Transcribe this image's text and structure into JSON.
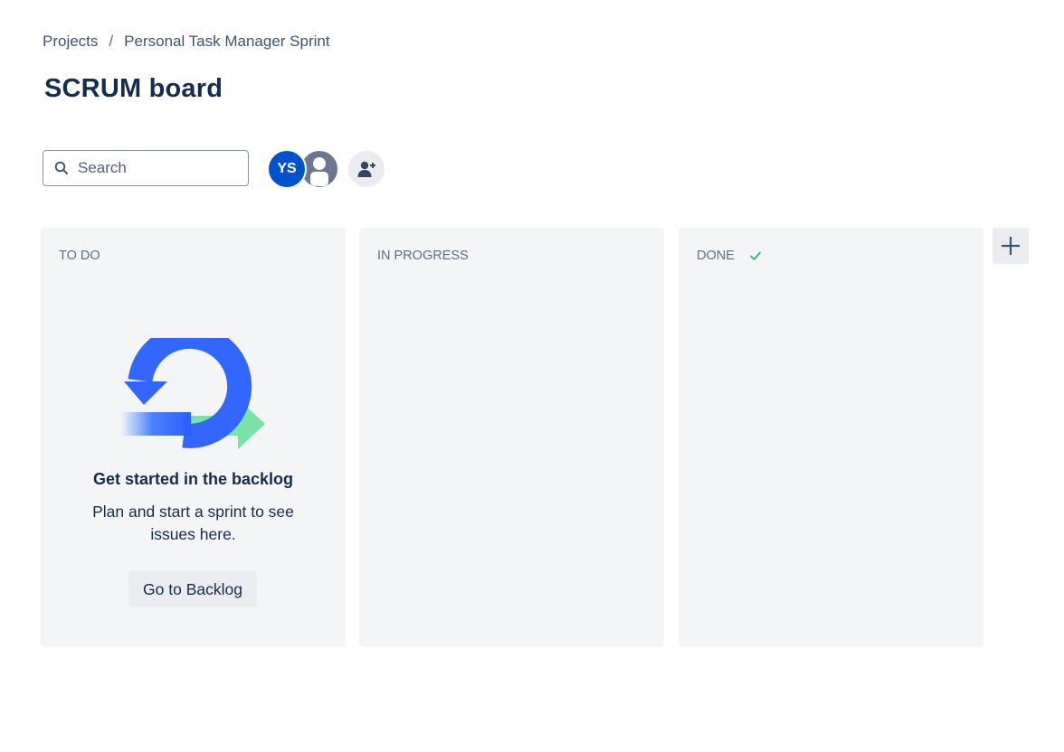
{
  "breadcrumb": {
    "items": [
      "Projects",
      "Personal Task Manager Sprint"
    ],
    "separator": "/"
  },
  "page_title": "SCRUM board",
  "search": {
    "placeholder": "Search",
    "value": ""
  },
  "avatars": [
    {
      "initials": "YS",
      "color": "#0052cc"
    },
    {
      "icon": "default-user-icon",
      "color": "#6b778c"
    }
  ],
  "add_people_icon": "add-user-icon",
  "columns": [
    {
      "title": "TO DO"
    },
    {
      "title": "IN PROGRESS"
    },
    {
      "title": "DONE",
      "icon": "check-icon",
      "icon_color": "#36b37e"
    }
  ],
  "empty_state": {
    "title": "Get started in the backlog",
    "description": "Plan and start a sprint to see issues here.",
    "button_label": "Go to Backlog"
  },
  "add_column_icon": "plus-icon",
  "colors": {
    "primary_text": "#172b4d",
    "subtle_text": "#5e6c84",
    "column_bg": "#f4f5f7",
    "brand_blue": "#0052cc",
    "success_green": "#36b37e"
  }
}
